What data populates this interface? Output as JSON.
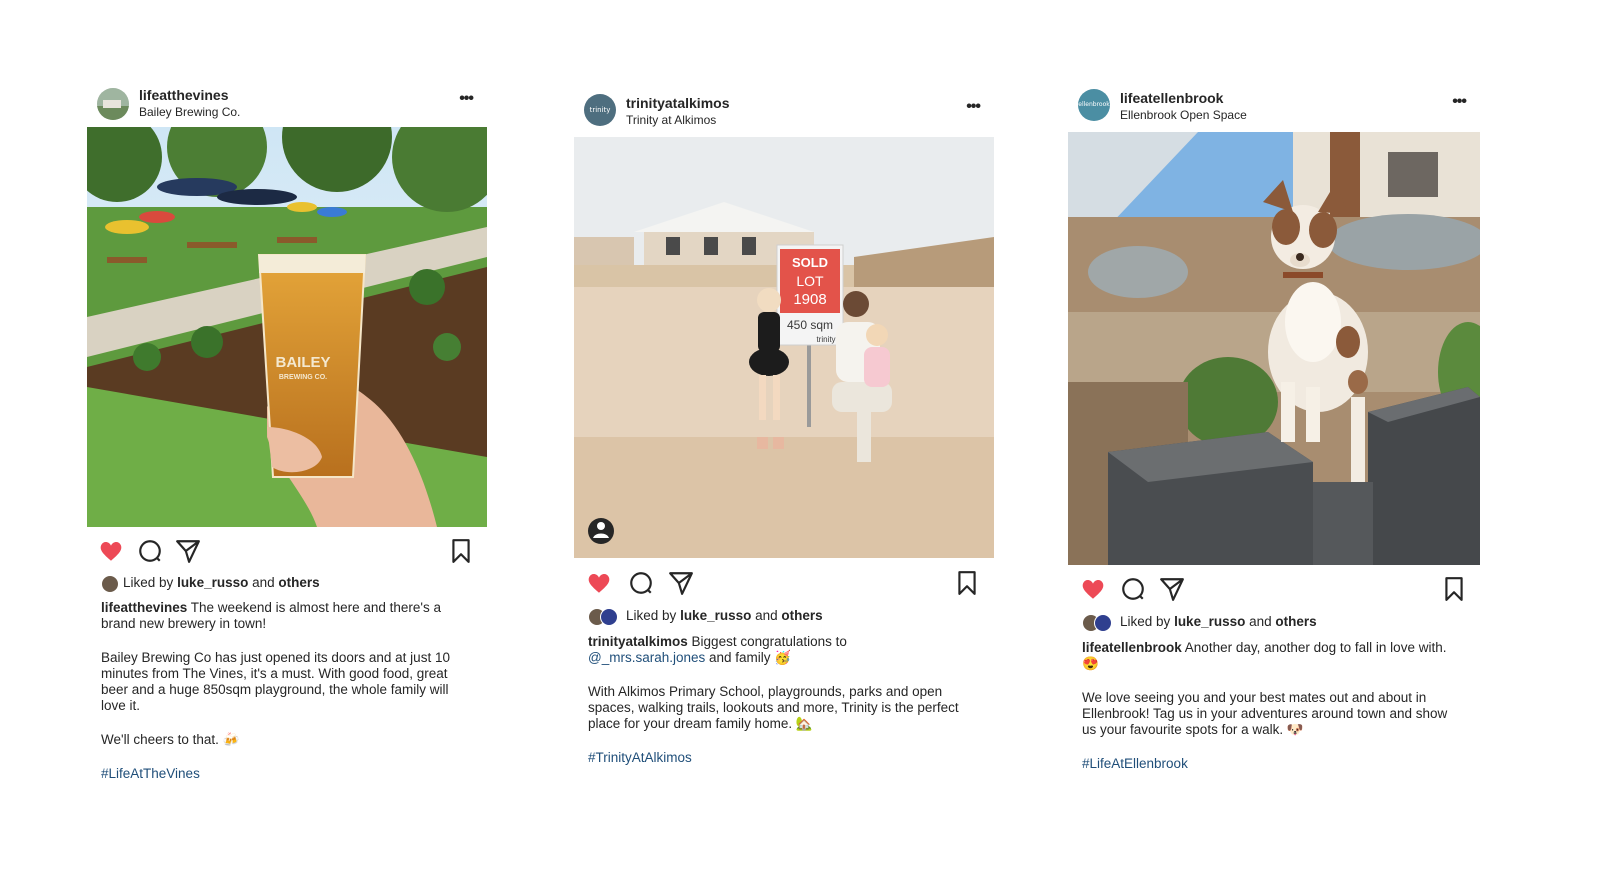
{
  "posts": [
    {
      "username": "lifeatthevines",
      "location": "Bailey Brewing Co.",
      "image_alt": "Hand holding a pint glass of beer printed with Bailey Brewing Co. in a beer garden",
      "glass_text_1": "BAILEY",
      "glass_text_2": "BREWING CO.",
      "liked_prefix": "Liked by",
      "liked_user": "luke_russo",
      "liked_and": "and",
      "liked_others": "others",
      "caption_user": "lifeatthevines",
      "caption_lead": "The weekend is almost here and there's a brand new brewery in town!",
      "paragraphs": [
        "Bailey Brewing Co has just opened its doors and at just 10 minutes from The Vines, it's a must. With good food, great beer and a huge 850sqm playground, the whole family will love it.",
        "We'll cheers to that. 🍻"
      ],
      "hashtag": "#LifeAtTheVines"
    },
    {
      "username": "trinityatalkimos",
      "location": "Trinity at Alkimos",
      "avatar_text": "trinity",
      "image_alt": "Mother with two children beside a SOLD sign on an empty sandy block",
      "sign_sold": "SOLD",
      "sign_lot": "LOT",
      "sign_number": "1908",
      "sign_size": "450 sqm",
      "sign_brand": "trinity",
      "liked_prefix": "Liked by",
      "liked_user": "luke_russo",
      "liked_and": "and",
      "liked_others": "others",
      "caption_user": "trinityatalkimos",
      "caption_lead": "Biggest congratulations to",
      "mention": "@_mrs.sarah.jones",
      "caption_tail": "and family 🥳",
      "paragraphs": [
        "With Alkimos Primary School, playgrounds, parks and open spaces, walking trails, lookouts and more, Trinity is the perfect place for your dream family home. 🏡"
      ],
      "hashtag": "#TrinityAtAlkimos"
    },
    {
      "username": "lifeatellenbrook",
      "location": "Ellenbrook Open Space",
      "avatar_text": "ellenbrook",
      "image_alt": "Australian shepherd dog standing on a concrete block wall",
      "liked_prefix": "Liked by",
      "liked_user": "luke_russo",
      "liked_and": "and",
      "liked_others": "others",
      "caption_user": "lifeatellenbrook",
      "caption_lead": "Another day, another dog to fall in love with. 😍",
      "paragraphs": [
        "We love seeing you and your best mates out and about in Ellenbrook! Tag us in your adventures around town and show us your favourite spots for a walk. 🐶"
      ],
      "hashtag": "#LifeAtEllenbrook"
    }
  ],
  "icons": {
    "like": "heart-icon",
    "comment": "comment-icon",
    "share": "paper-plane-icon",
    "save": "bookmark-icon",
    "more": "more-options-icon",
    "tagged": "tagged-person-icon"
  },
  "colors": {
    "like_red": "#ed4956",
    "text": "#262626",
    "link": "#1f4e79"
  }
}
